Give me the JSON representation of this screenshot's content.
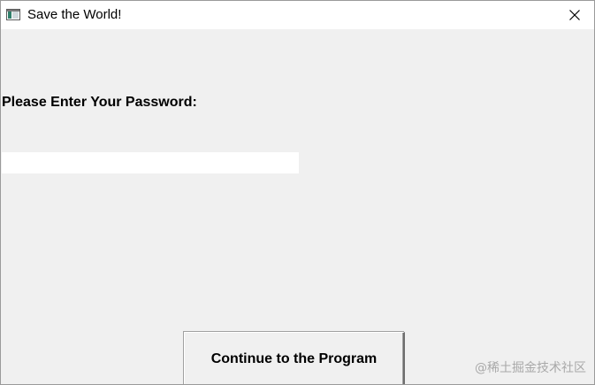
{
  "window": {
    "title": "Save the World!",
    "icon": "application-window-icon",
    "close_icon": "close-icon"
  },
  "form": {
    "prompt_label": "Please Enter Your Password:",
    "password_value": "",
    "continue_label": "Continue to the Program"
  },
  "watermark": {
    "text": "@稀土掘金技术社区"
  },
  "colors": {
    "window_background": "#f0f0f0",
    "titlebar_background": "#ffffff",
    "input_background": "#ffffff",
    "text": "#000000"
  }
}
